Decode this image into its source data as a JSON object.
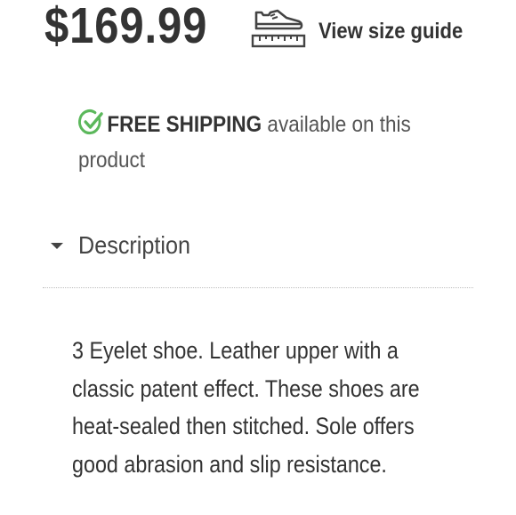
{
  "product": {
    "price": "$169.99"
  },
  "size_guide": {
    "icon": "shoe-ruler-icon",
    "label": "View size guide"
  },
  "shipping": {
    "icon": "check-circle-icon",
    "icon_color": "#5cb85c",
    "highlight": "FREE SHIPPING",
    "rest": " available on this product"
  },
  "description": {
    "toggle_icon": "caret-down-icon",
    "label": "Description",
    "text": "3 Eyelet shoe. Leather upper with a classic patent effect. These shoes are heat-sealed then stitched. Sole offers good abrasion and slip resistance."
  }
}
